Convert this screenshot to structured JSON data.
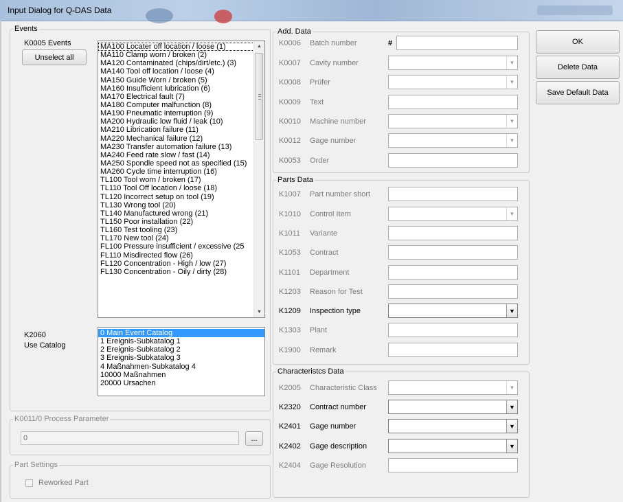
{
  "window": {
    "title": "Input Dialog for Q-DAS Data"
  },
  "events": {
    "legend": "Events",
    "k_label": "K0005  Events",
    "unselect_label": "Unselect all",
    "items": [
      "MA100  Locater off location / loose  (1)",
      "MA110  Clamp worn / broken  (2)",
      "MA120  Contaminated (chips/dirt/etc.)  (3)",
      "MA140  Tool off location / loose  (4)",
      "MA150  Guide Worn / broken  (5)",
      "MA160  Insufficient lubrication  (6)",
      "MA170  Electrical fault  (7)",
      "MA180  Computer malfunction  (8)",
      "MA190  Pneumatic interruption  (9)",
      "MA200  Hydraulic low fluid / leak  (10)",
      "MA210  Librication failure  (11)",
      "MA220  Mechanical failure  (12)",
      "MA230  Transfer automation failure  (13)",
      "MA240  Feed rate slow / fast  (14)",
      "MA250  Spondle speed not as specified  (15)",
      "MA260  Cycle time interruption  (16)",
      "TL100  Tool worn / broken  (17)",
      "TL110  Tool Off location / loose  (18)",
      "TL120  Incorrect setup on tool  (19)",
      "TL130  Wrong tool  (20)",
      "TL140  Manufactured wrong  (21)",
      "TL150  Poor installation  (22)",
      "TL160  Test tooling  (23)",
      "TL170  New tool  (24)",
      "FL100  Pressure insufficient / excessive  (25",
      "FL110  Misdirected flow  (26)",
      "FL120  Concentration - High / low  (27)",
      "FL130  Concentration - Oily / dirty  (28)"
    ],
    "catalog_code": "K2060",
    "catalog_label": "Use Catalog",
    "catalog_items": [
      "0  Main Event Catalog",
      "1  Ereignis-Subkatalog 1",
      "2  Ereignis-Subkatalog 2",
      "3  Ereignis-Subkatalog 3",
      "4  Maßnahmen-Subkatalog 4",
      "10000  Maßnahmen",
      "20000  Ursachen"
    ]
  },
  "process": {
    "legend": "K0011/0 Process Parameter",
    "value": "0",
    "browse_label": "..."
  },
  "part_settings": {
    "legend": "Part Settings",
    "reworked_label": "Reworked Part"
  },
  "add_data": {
    "legend": "Add. Data",
    "hash_label": "#",
    "rows": [
      {
        "code": "K0006",
        "label": "Batch number"
      },
      {
        "code": "K0007",
        "label": "Cavity number"
      },
      {
        "code": "K0008",
        "label": "Prüfer"
      },
      {
        "code": "K0009",
        "label": "Text"
      },
      {
        "code": "K0010",
        "label": "Machine number"
      },
      {
        "code": "K0012",
        "label": "Gage number"
      },
      {
        "code": "K0053",
        "label": "Order"
      }
    ]
  },
  "parts_data": {
    "legend": "Parts Data",
    "rows": [
      {
        "code": "K1007",
        "label": "Part number short"
      },
      {
        "code": "K1010",
        "label": "Control Item"
      },
      {
        "code": "K1011",
        "label": "Variante"
      },
      {
        "code": "K1053",
        "label": "Contract"
      },
      {
        "code": "K1101",
        "label": "Department"
      },
      {
        "code": "K1203",
        "label": "Reason for Test"
      },
      {
        "code": "K1209",
        "label": "Inspection type"
      },
      {
        "code": "K1303",
        "label": "Plant"
      },
      {
        "code": "K1900",
        "label": "Remark"
      }
    ]
  },
  "char_data": {
    "legend": "Characteristcs Data",
    "rows": [
      {
        "code": "K2005",
        "label": "Characteristic Class"
      },
      {
        "code": "K2320",
        "label": "Contract number"
      },
      {
        "code": "K2401",
        "label": "Gage number"
      },
      {
        "code": "K2402",
        "label": "Gage description"
      },
      {
        "code": "K2404",
        "label": "Gage Resolution"
      }
    ]
  },
  "buttons": {
    "ok": "OK",
    "delete": "Delete Data",
    "save_default": "Save Default Data"
  },
  "icons": {
    "dropdown": "dropdown-arrow-icon",
    "scroll_up": "scroll-up-icon",
    "scroll_down": "scroll-down-icon"
  }
}
